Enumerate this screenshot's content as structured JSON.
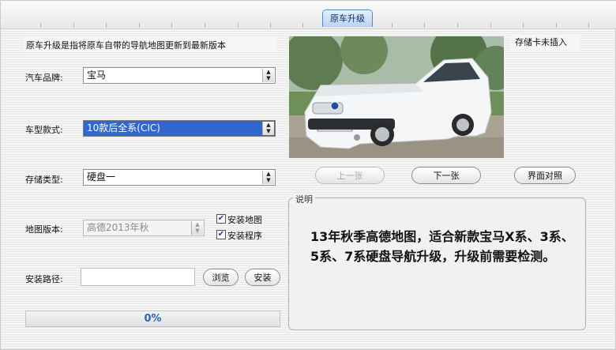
{
  "tab": {
    "label": "原车升级"
  },
  "intro": "原车升级是指将原车自带的导航地图更新到最新版本",
  "storage_card_status": "存储卡未插入",
  "fields": {
    "brand": {
      "label": "汽车品牌:",
      "value": "宝马"
    },
    "model": {
      "label": "车型款式:",
      "value": "10款后全系(CIC)"
    },
    "storage_type": {
      "label": "存储类型:",
      "value": "硬盘一"
    },
    "map_version": {
      "label": "地图版本:",
      "value": "高德2013年秋"
    },
    "install_path": {
      "label": "安装路径:",
      "value": ""
    }
  },
  "checkboxes": {
    "install_map": {
      "label": "安装地图",
      "checked": true
    },
    "install_program": {
      "label": "安装程序",
      "checked": true
    }
  },
  "buttons": {
    "prev": "上一张",
    "next": "下一张",
    "compare": "界面对照",
    "browse": "浏览",
    "install": "安装"
  },
  "description": {
    "title": "说明",
    "text": "13年秋季高德地图，适合新款宝马X系、3系、5系、7系硬盘导航升级，升级前需要检测。"
  },
  "progress": {
    "percent": 0,
    "label": "0%"
  },
  "colors": {
    "selection": "#3166cc",
    "progress_text": "#2e63b8",
    "tab": "#b8d2f6"
  },
  "icons": {
    "photo": "car-photo",
    "spin": "spin-arrows-icon"
  }
}
